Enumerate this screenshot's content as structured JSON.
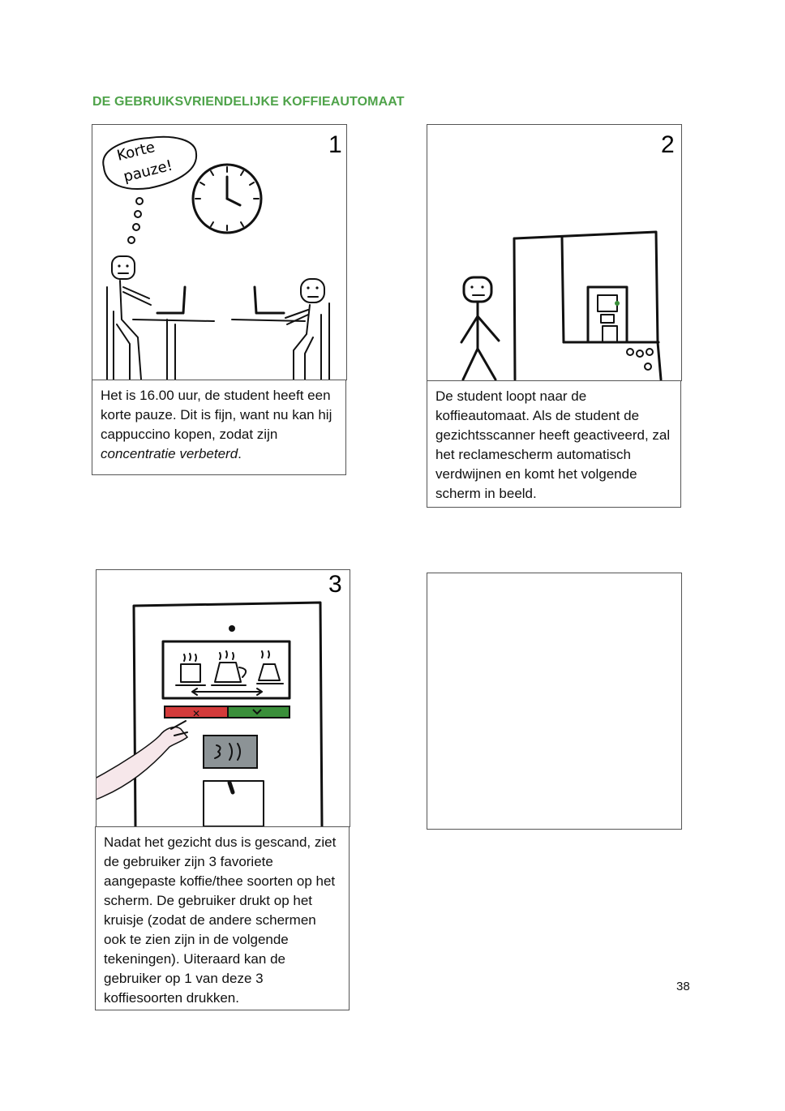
{
  "heading": "DE GEBRUIKSVRIENDELIJKE KOFFIEAUTOMAAT",
  "panels": [
    {
      "number": "1",
      "speech": [
        "Korte",
        "pauze!"
      ],
      "caption_plain": "Het is 16.00 uur, de student heeft een korte pauze. Dit is fijn, want nu kan hij cappuccino kopen, zodat zijn ",
      "caption_italic": "concentratie verbeterd",
      "caption_end": "."
    },
    {
      "number": "2",
      "caption": "De student loopt naar de koffieautomaat. Als de student de gezichtsscanner heeft geactiveerd, zal het reclamescherm automatisch verdwijnen en komt het volgende scherm in beeld."
    },
    {
      "number": "3",
      "caption": "Nadat het gezicht dus is gescand, ziet de gebruiker zijn 3 favoriete aangepaste koffie/thee soorten op het scherm. De gebruiker drukt op het kruisje (zodat de andere schermen ook te zien zijn in de volgende tekeningen). Uiteraard kan de gebruiker op 1 van deze 3 koffiesoorten drukken.",
      "colors": {
        "cancel": "#d33a3a",
        "confirm": "#3a8f3a",
        "scanner": "#8c9396",
        "arm": "#f6e7ea"
      }
    },
    {
      "number": ""
    }
  ],
  "page_number": "38"
}
